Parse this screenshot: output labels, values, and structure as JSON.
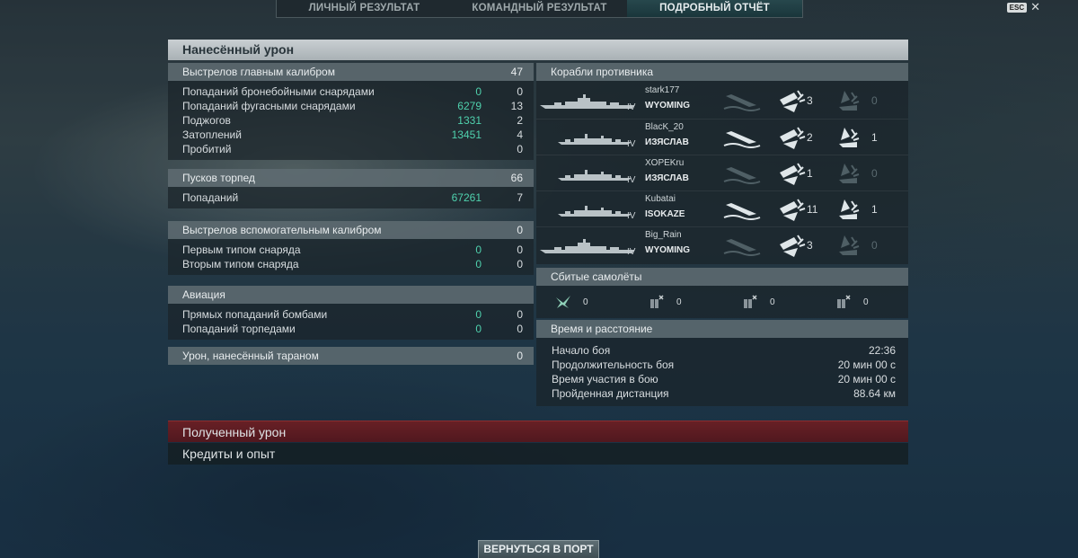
{
  "tabs": [
    "ЛИЧНЫЙ РЕЗУЛЬТАТ",
    "КОМАНДНЫЙ РЕЗУЛЬТАТ",
    "ПОДРОБНЫЙ ОТЧЁТ"
  ],
  "esc_label": "ESC",
  "close_glyph": "✕",
  "panel_title": "Нанесённый урон",
  "left": {
    "main_battery": {
      "label": "Выстрелов главным калибром",
      "value": "47",
      "rows": [
        {
          "label": "Попаданий бронебойными снарядами",
          "damage": "0",
          "count": "0"
        },
        {
          "label": "Попаданий фугасными снарядами",
          "damage": "6279",
          "count": "13"
        },
        {
          "label": "Поджогов",
          "damage": "1331",
          "count": "2"
        },
        {
          "label": "Затоплений",
          "damage": "13451",
          "count": "4"
        },
        {
          "label": "Пробитий",
          "damage": "",
          "count": "0"
        }
      ]
    },
    "torpedoes": {
      "label": "Пусков торпед",
      "value": "66",
      "rows": [
        {
          "label": "Попаданий",
          "damage": "67261",
          "count": "7"
        }
      ]
    },
    "secondary": {
      "label": "Выстрелов вспомогательным калибром",
      "value": "0",
      "rows": [
        {
          "label": "Первым типом снаряда",
          "damage": "0",
          "count": "0"
        },
        {
          "label": "Вторым типом снаряда",
          "damage": "0",
          "count": "0"
        }
      ]
    },
    "aviation": {
      "label": "Авиация",
      "rows": [
        {
          "label": "Прямых попаданий бомбами",
          "damage": "0",
          "count": "0"
        },
        {
          "label": "Попаданий торпедами",
          "damage": "0",
          "count": "0"
        }
      ]
    },
    "ramming": {
      "label": "Урон, нанесённый тараном",
      "value": "0"
    }
  },
  "right": {
    "enemies_title": "Корабли противника",
    "enemies": [
      {
        "player": "stark177",
        "ship": "WYOMING",
        "tier": "IV",
        "type": "battleship",
        "destroyed": false,
        "hits_a": "3",
        "hits_b": "0"
      },
      {
        "player": "BlacK_20",
        "ship": "ИЗЯСЛАВ",
        "tier": "IV",
        "type": "destroyer",
        "destroyed": true,
        "hits_a": "2",
        "hits_b": "1"
      },
      {
        "player": "XOPEKru",
        "ship": "ИЗЯСЛАВ",
        "tier": "IV",
        "type": "destroyer",
        "destroyed": false,
        "hits_a": "1",
        "hits_b": "0"
      },
      {
        "player": "Kubatai",
        "ship": "ISOKAZE",
        "tier": "IV",
        "type": "destroyer",
        "destroyed": true,
        "hits_a": "11",
        "hits_b": "1"
      },
      {
        "player": "Big_Rain",
        "ship": "WYOMING",
        "tier": "IV",
        "type": "battleship",
        "destroyed": false,
        "hits_a": "3",
        "hits_b": "0"
      }
    ],
    "planes_title": "Сбитые самолёты",
    "planes": [
      {
        "icon": "aircraft-icon",
        "count": "0"
      },
      {
        "icon": "fighter-ammo-icon",
        "count": "0"
      },
      {
        "icon": "bomber-ammo-icon",
        "count": "0"
      },
      {
        "icon": "torpedo-bomber-ammo-icon",
        "count": "0"
      }
    ],
    "time_title": "Время и расстояние",
    "time_rows": [
      {
        "label": "Начало боя",
        "value": "22:36"
      },
      {
        "label": "Продолжительность боя",
        "value": "20 мин 00 с"
      },
      {
        "label": "Время участия в бою",
        "value": "20 мин 00 с"
      },
      {
        "label": "Пройденная дистанция",
        "value": "88.64 км"
      }
    ]
  },
  "received_damage_label": "Полученный урон",
  "credits_label": "Кредиты и опыт",
  "return_button": "ВЕРНУТЬСЯ В ПОРТ"
}
